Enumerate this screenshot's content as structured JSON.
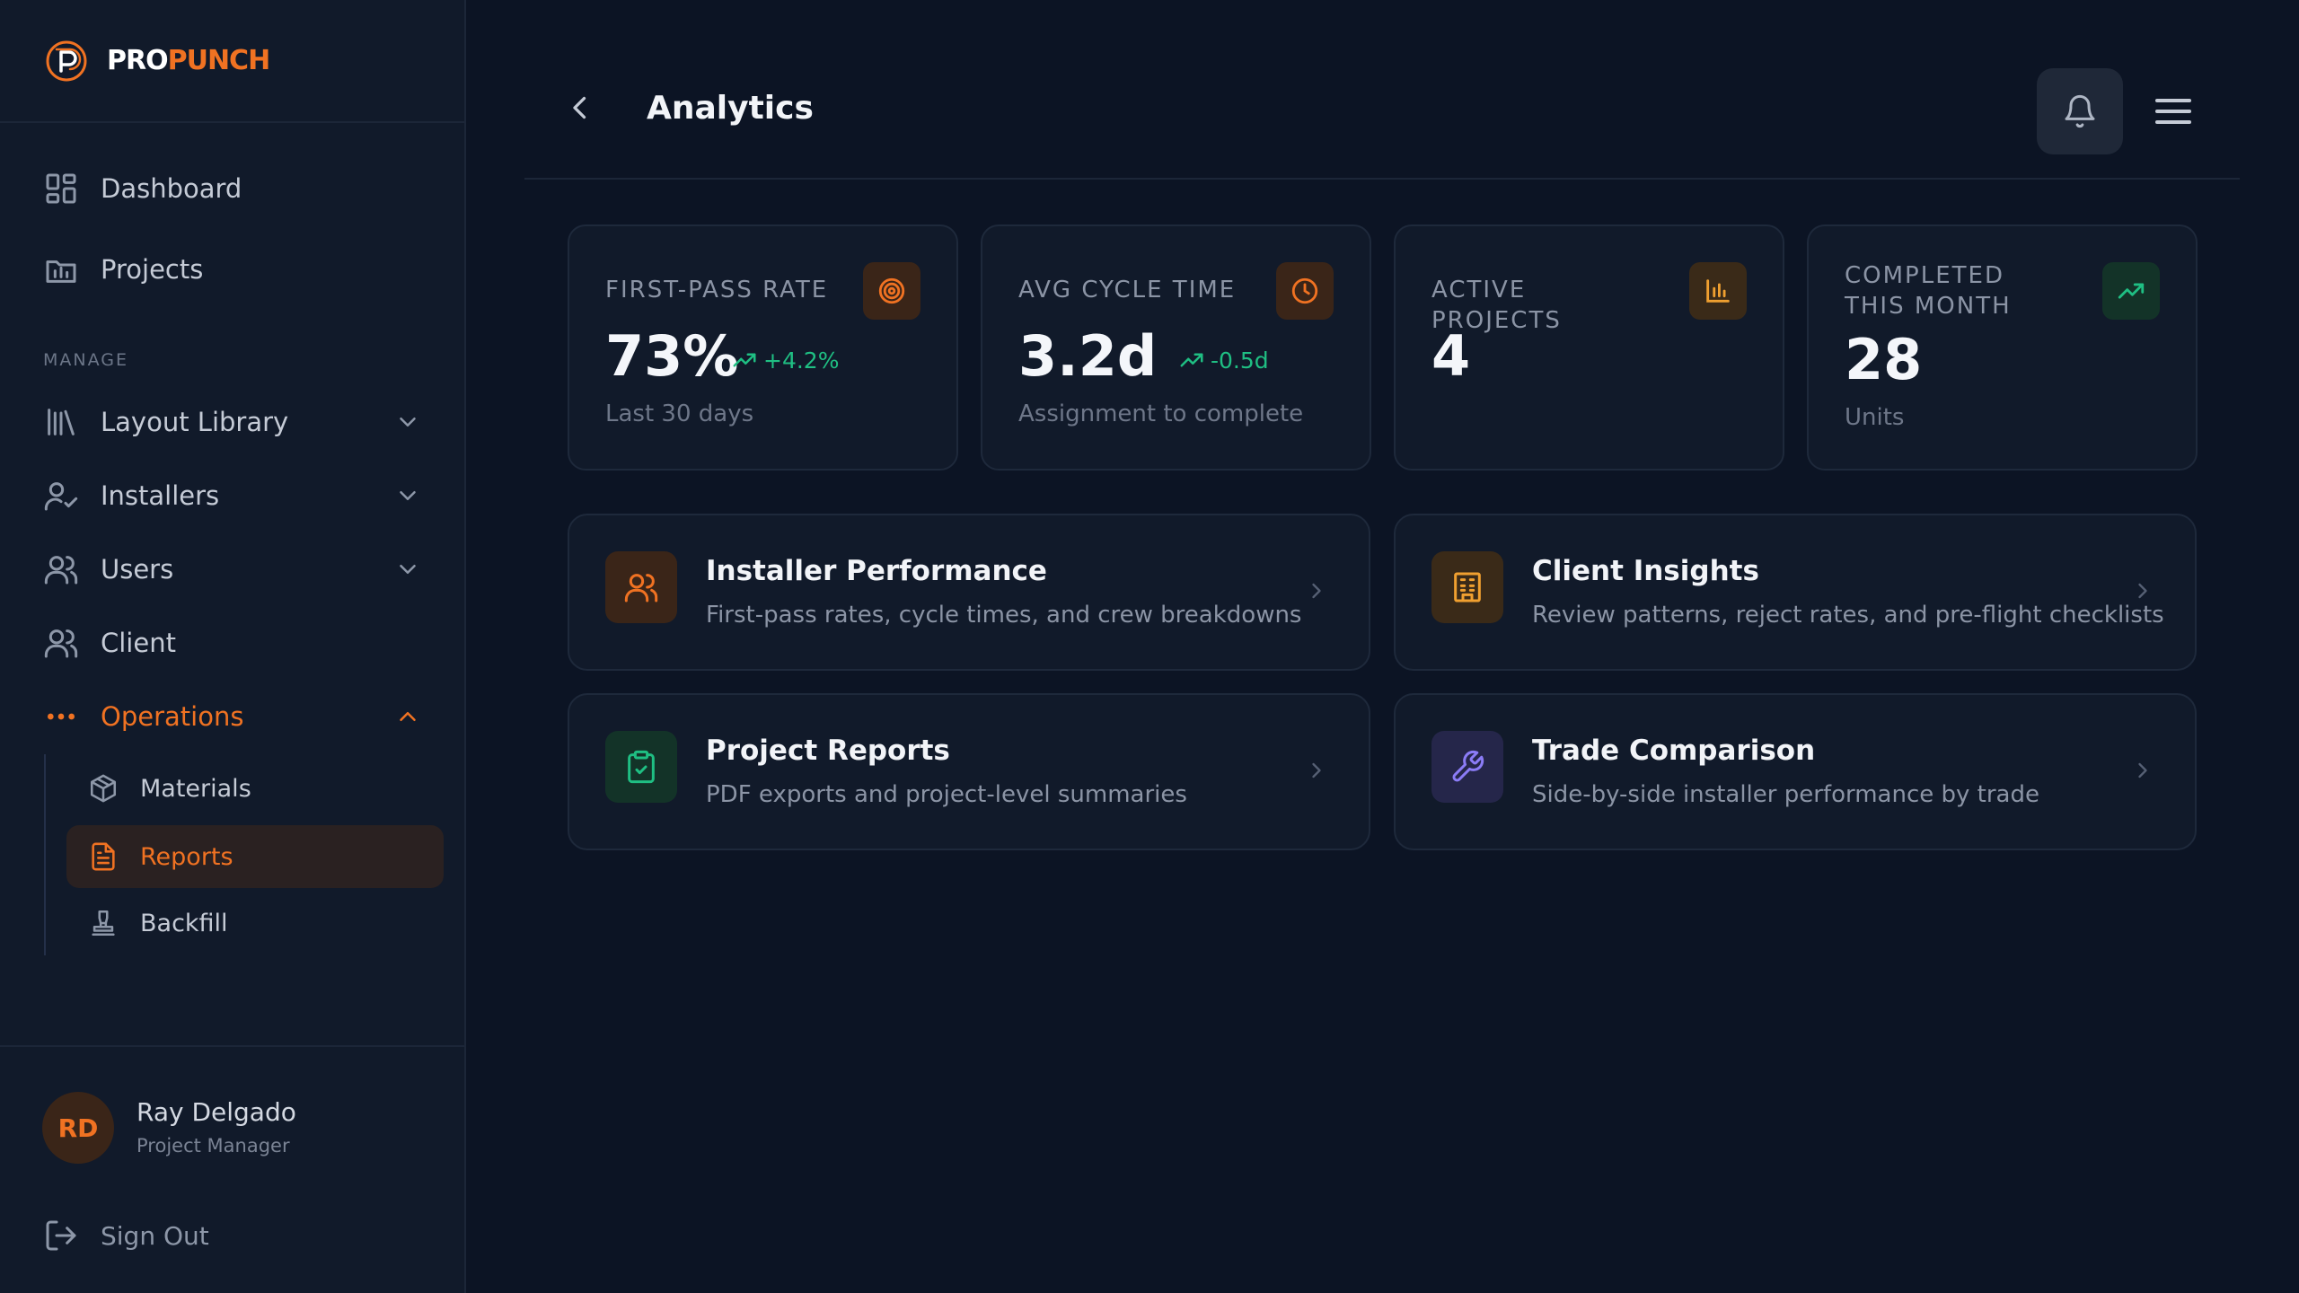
{
  "brand": {
    "part1": "PRO",
    "part2": "PUNCH"
  },
  "sidebar": {
    "top_items": [
      {
        "label": "Dashboard",
        "icon": "dashboard-grid-icon"
      },
      {
        "label": "Projects",
        "icon": "projects-chart-icon"
      }
    ],
    "section_label": "MANAGE",
    "manage_items": [
      {
        "label": "Layout Library",
        "icon": "library-icon",
        "expandable": true
      },
      {
        "label": "Installers",
        "icon": "installer-icon",
        "expandable": true
      },
      {
        "label": "Users",
        "icon": "users-icon",
        "expandable": true
      },
      {
        "label": "Client",
        "icon": "client-icon",
        "expandable": false
      },
      {
        "label": "Operations",
        "icon": "more-dots-icon",
        "expanded": true,
        "active": true
      }
    ],
    "operations_sub": [
      {
        "label": "Materials",
        "icon": "box-icon"
      },
      {
        "label": "Reports",
        "icon": "document-icon",
        "active": true
      },
      {
        "label": "Backfill",
        "icon": "stamp-icon"
      }
    ]
  },
  "user": {
    "initials": "RD",
    "name": "Ray Delgado",
    "role": "Project Manager",
    "sign_out": "Sign Out"
  },
  "header": {
    "title": "Analytics"
  },
  "stats": [
    {
      "label": "FIRST-PASS RATE",
      "value": "73%",
      "delta": "+4.2%",
      "sub": "Last 30 days",
      "icon": "target-icon",
      "accent": "#f07222"
    },
    {
      "label": "AVG CYCLE TIME",
      "value": "3.2d",
      "delta": "-0.5d",
      "sub": "Assignment to complete",
      "icon": "clock-icon",
      "accent": "#f07222"
    },
    {
      "label": "ACTIVE PROJECTS",
      "value": "4",
      "delta": "",
      "sub": "",
      "icon": "bar-chart-icon",
      "accent": "#f0a030"
    },
    {
      "label": "COMPLETED THIS MONTH",
      "value": "28",
      "delta": "",
      "sub": "Units",
      "icon": "trending-up-icon",
      "accent": "#1fbf83"
    }
  ],
  "reports": [
    {
      "title": "Installer Performance",
      "desc": "First-pass rates, cycle times, and crew breakdowns",
      "icon": "users-icon",
      "accent": "#f07222"
    },
    {
      "title": "Client Insights",
      "desc": "Review patterns, reject rates, and pre-flight checklists",
      "icon": "building-icon",
      "accent": "#f0a030"
    },
    {
      "title": "Project Reports",
      "desc": "PDF exports and project-level summaries",
      "icon": "clipboard-check-icon",
      "accent": "#1fbf83"
    },
    {
      "title": "Trade Comparison",
      "desc": "Side-by-side installer performance by trade",
      "icon": "wrench-icon",
      "accent": "#8b7cf6"
    }
  ],
  "colors": {
    "accent": "#f07222",
    "positive": "#1fbf83",
    "background": "#0c1424",
    "sidebar": "#111a2a"
  }
}
